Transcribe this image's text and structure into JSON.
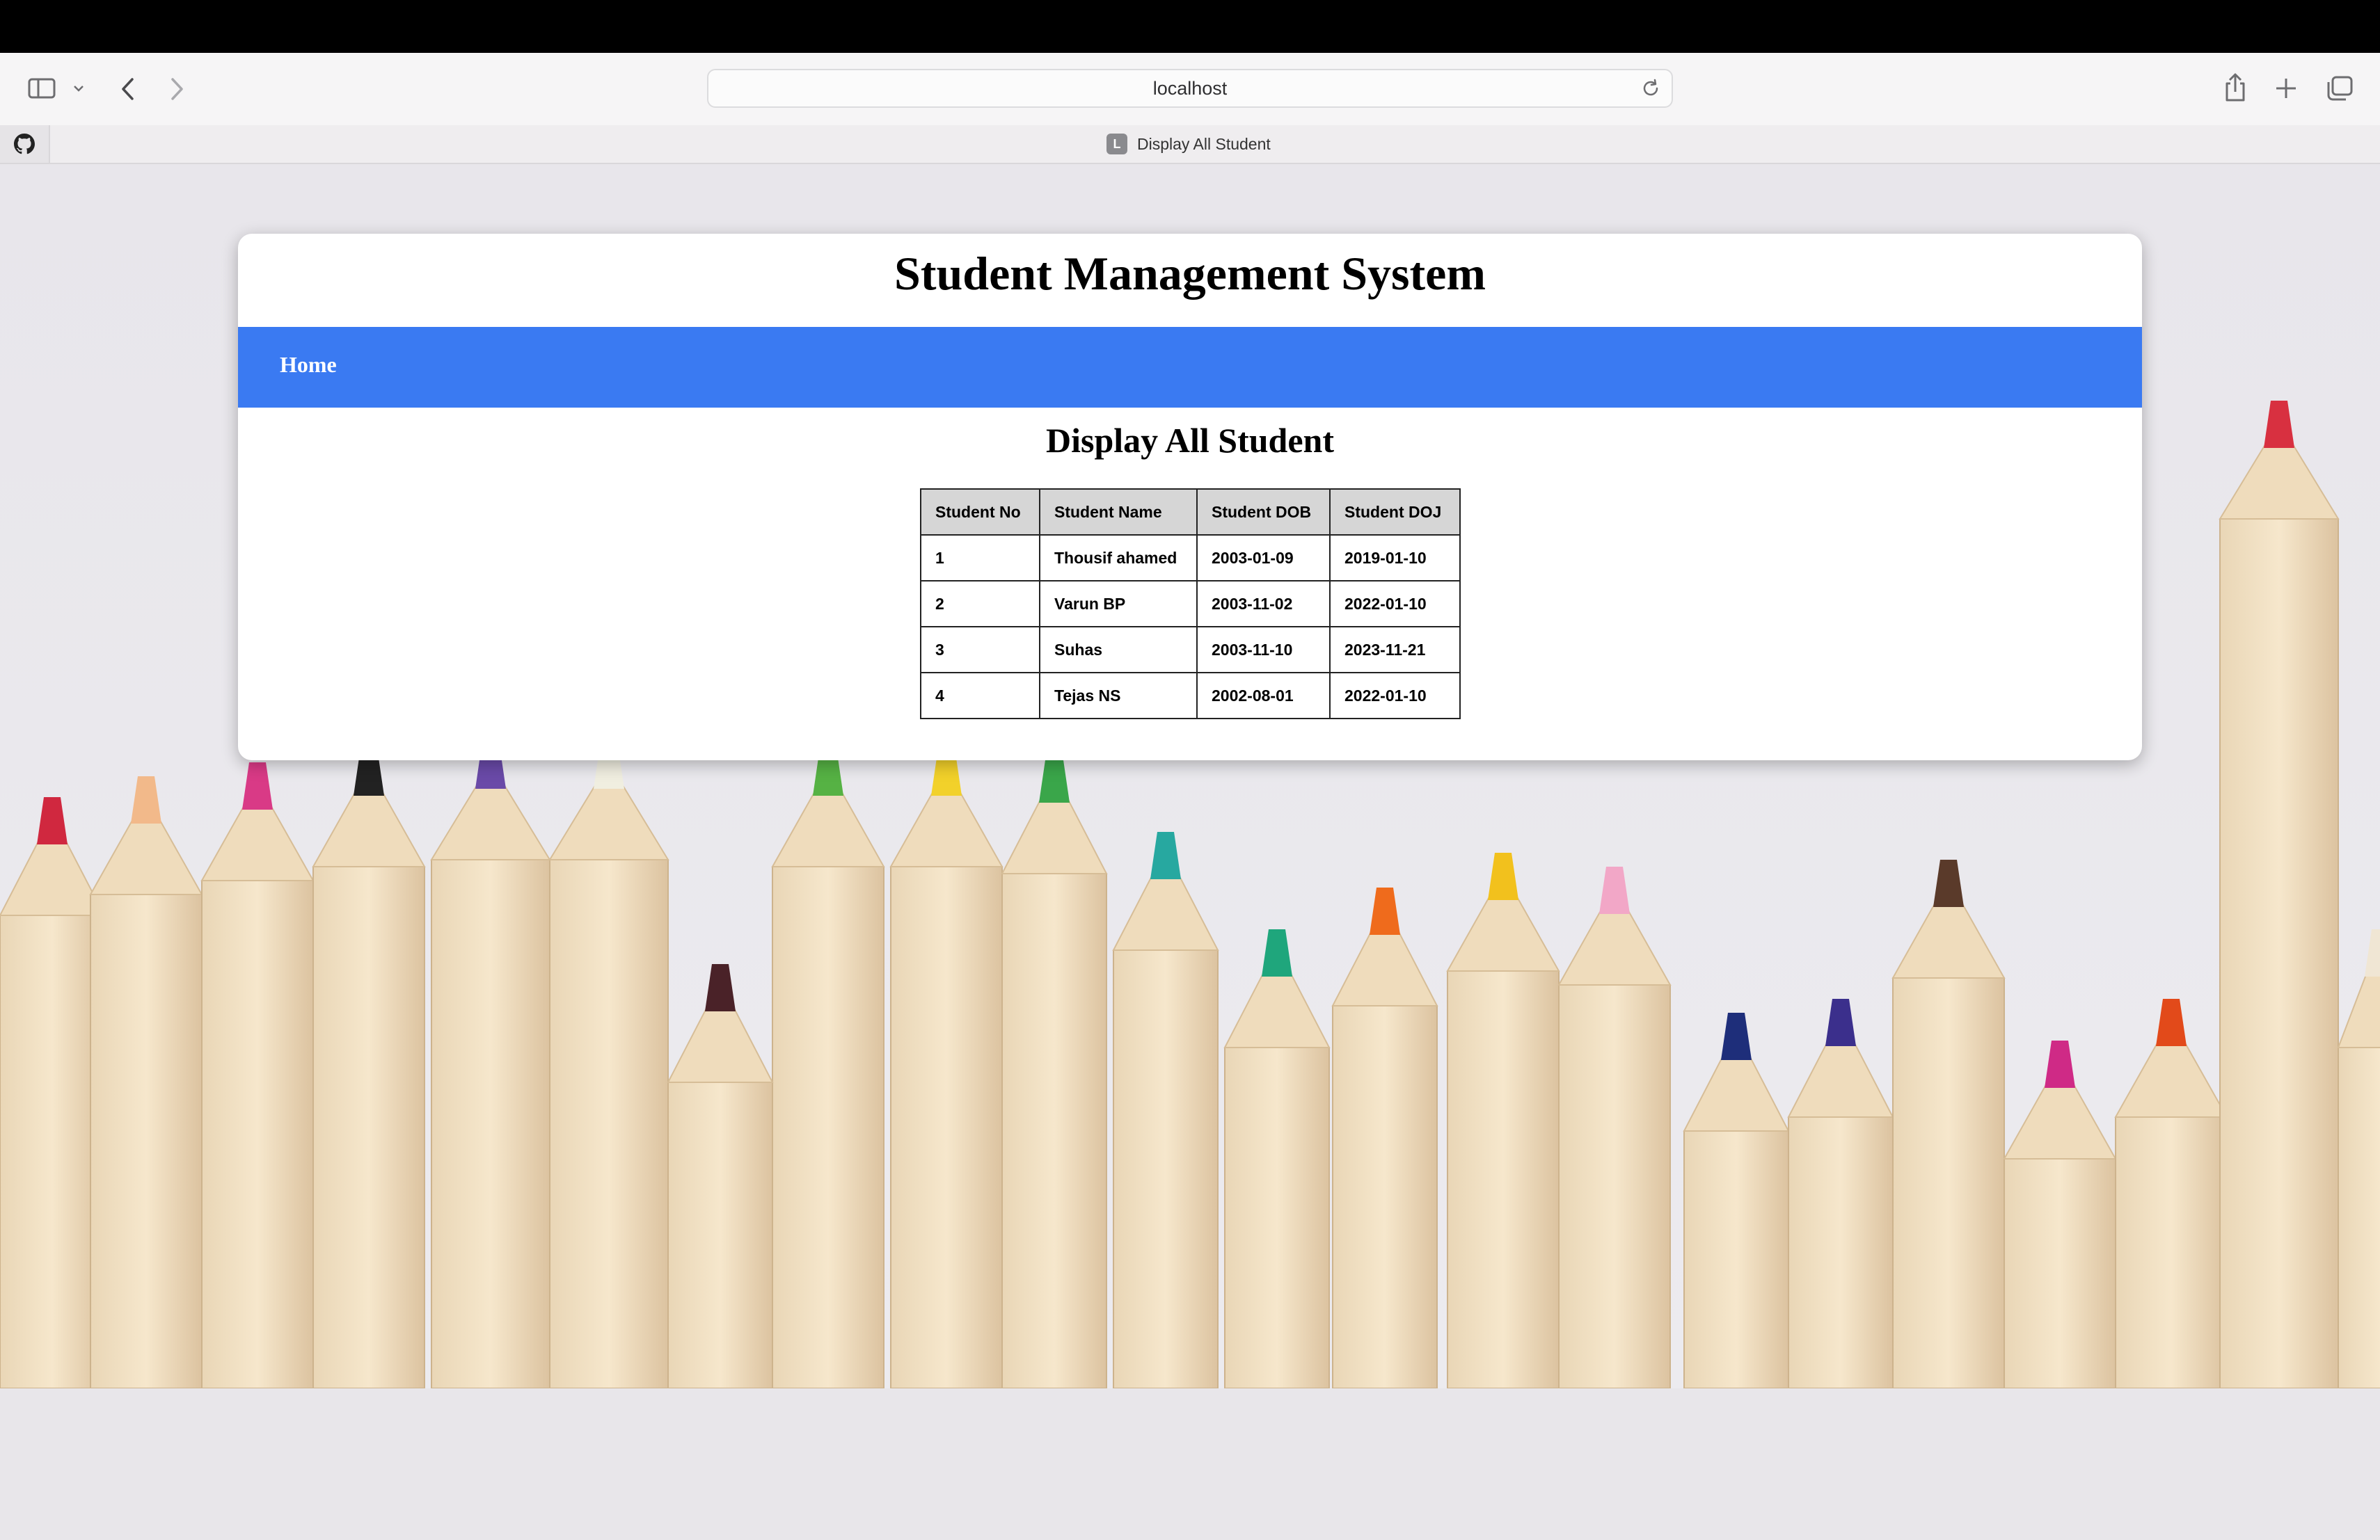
{
  "browser": {
    "url": "localhost",
    "tab_title": "Display All Student",
    "tab_favicon_letter": "L",
    "icons": [
      "sidebar-icon",
      "chevron-down-icon",
      "back-icon",
      "forward-icon",
      "reload-icon",
      "share-icon",
      "plus-icon",
      "tabs-overview-icon",
      "github-icon"
    ]
  },
  "page": {
    "site_title": "Student Management System",
    "nav": {
      "home_label": "Home"
    },
    "heading": "Display All Student",
    "accent_color": "#3a7af2"
  },
  "table": {
    "headers": [
      "Student No",
      "Student Name",
      "Student DOB",
      "Student DOJ"
    ],
    "rows": [
      [
        "1",
        "Thousif ahamed",
        "2003-01-09",
        "2019-01-10"
      ],
      [
        "2",
        "Varun BP",
        "2003-11-02",
        "2022-01-10"
      ],
      [
        "3",
        "Suhas",
        "2003-11-10",
        "2023-11-21"
      ],
      [
        "4",
        "Tejas NS",
        "2002-08-01",
        "2022-01-10"
      ]
    ]
  }
}
